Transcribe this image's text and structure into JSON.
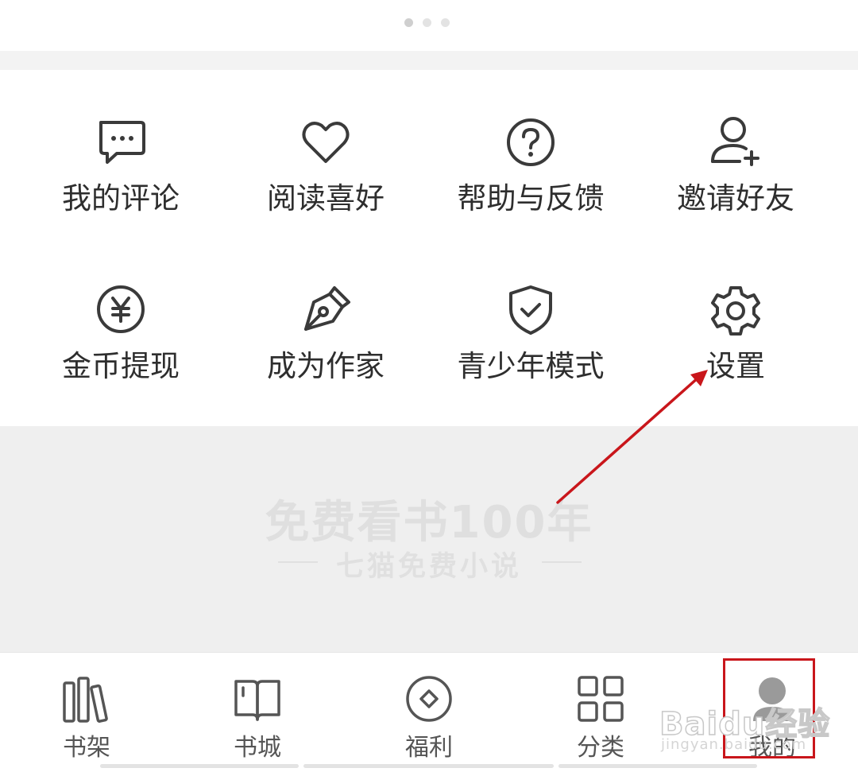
{
  "carousel": {
    "count": 3,
    "active": 0
  },
  "menu": [
    {
      "label": "我的评论",
      "icon": "comment-icon"
    },
    {
      "label": "阅读喜好",
      "icon": "heart-icon"
    },
    {
      "label": "帮助与反馈",
      "icon": "help-icon"
    },
    {
      "label": "邀请好友",
      "icon": "add-friend-icon"
    },
    {
      "label": "金币提现",
      "icon": "yuan-coin-icon"
    },
    {
      "label": "成为作家",
      "icon": "pen-nib-icon"
    },
    {
      "label": "青少年模式",
      "icon": "shield-check-icon"
    },
    {
      "label": "设置",
      "icon": "gear-icon"
    }
  ],
  "promo": {
    "title": "免费看书100年",
    "subtitle": "七猫免费小说"
  },
  "tabs": [
    {
      "label": "书架",
      "icon": "bookshelf-icon"
    },
    {
      "label": "书城",
      "icon": "book-icon"
    },
    {
      "label": "福利",
      "icon": "welfare-icon"
    },
    {
      "label": "分类",
      "icon": "grid-icon"
    },
    {
      "label": "我的",
      "icon": "user-icon",
      "active": true
    }
  ],
  "watermark": {
    "brand": "Baidu经验",
    "url": "jingyan.baidu.com"
  },
  "colors": {
    "annotation": "#c9161b",
    "icon": "#333333",
    "background": "#efefef"
  }
}
